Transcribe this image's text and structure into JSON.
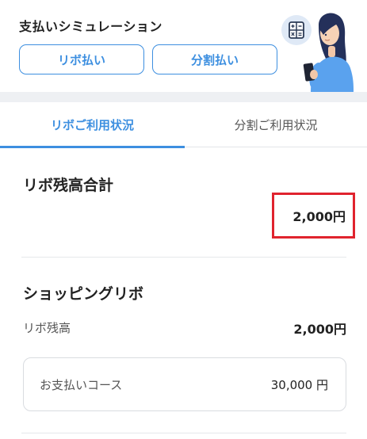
{
  "simulation": {
    "title": "支払いシミュレーション",
    "revo_button": "リボ払い",
    "split_button": "分割払い",
    "calculator_icon": "calculator-icon"
  },
  "tabs": [
    {
      "label": "リボご利用状況",
      "active": true
    },
    {
      "label": "分割ご利用状況",
      "active": false
    }
  ],
  "revo_total": {
    "heading": "リボ残高合計",
    "amount": "2,000円",
    "highlight_color": "#e0232e"
  },
  "shopping_revo": {
    "heading": "ショッピングリボ",
    "balance_label": "リボ残高",
    "balance_value": "2,000円",
    "course_label": "お支払いコース",
    "course_value": "30,000 円"
  },
  "colors": {
    "accent": "#3d8fe0",
    "highlight": "#e0232e"
  }
}
